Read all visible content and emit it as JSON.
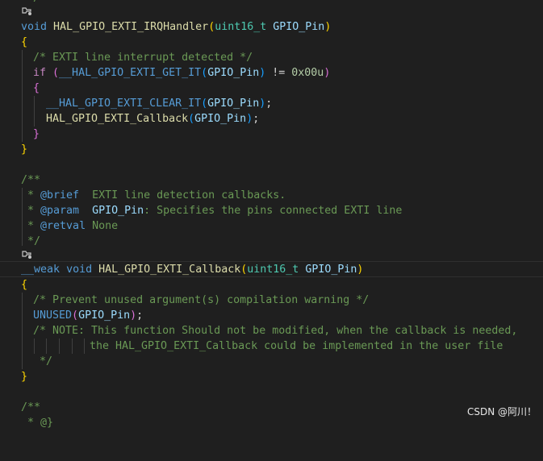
{
  "code": {
    "top_fragment": "/",
    "l1": {
      "void": "void",
      "name": "HAL_GPIO_EXTI_IRQHandler",
      "po": "(",
      "type": "uint16_t",
      "param": "GPIO_Pin",
      "pc": ")"
    },
    "l2": {
      "brace": "{"
    },
    "l3": {
      "comment": "/* EXTI line interrupt detected */"
    },
    "l4": {
      "if": "if",
      "po": "(",
      "macro": "__HAL_GPIO_EXTI_GET_IT",
      "mpo": "(",
      "arg": "GPIO_Pin",
      "mpc": ")",
      "op": " != ",
      "num": "0x00u",
      "pc": ")"
    },
    "l5": {
      "brace": "{"
    },
    "l6": {
      "macro": "__HAL_GPIO_EXTI_CLEAR_IT",
      "po": "(",
      "arg": "GPIO_Pin",
      "pc": ")",
      "semi": ";"
    },
    "l7": {
      "fn": "HAL_GPIO_EXTI_Callback",
      "po": "(",
      "arg": "GPIO_Pin",
      "pc": ")",
      "semi": ";"
    },
    "l8": {
      "brace": "}"
    },
    "l9": {
      "brace": "}"
    },
    "l11": {
      "text": "/**"
    },
    "l12": {
      "star": " * ",
      "tag": "@brief",
      "text": "  EXTI line detection callbacks."
    },
    "l13": {
      "star": " * ",
      "tag": "@param",
      "space": "  ",
      "param": "GPIO_Pin",
      "text": ": Specifies the pins connected EXTI line"
    },
    "l14": {
      "star": " * ",
      "tag": "@retval",
      "text": " None"
    },
    "l15": {
      "text": " */"
    },
    "l16": {
      "weak": "__weak",
      "void": "void",
      "name": "HAL_GPIO_EXTI_Callback",
      "po": "(",
      "type": "uint16_t",
      "param": "GPIO_Pin",
      "pc": ")"
    },
    "l17": {
      "brace": "{"
    },
    "l18": {
      "comment": "/* Prevent unused argument(s) compilation warning */"
    },
    "l19": {
      "macro": "UNUSED",
      "po": "(",
      "arg": "GPIO_Pin",
      "pc": ")",
      "semi": ";"
    },
    "l20": {
      "comment": "/* NOTE: This function Should not be modified, when the callback is needed,"
    },
    "l21": {
      "comment": "the HAL_GPIO_EXTI_Callback could be implemented in the user file"
    },
    "l22": {
      "comment": " */"
    },
    "l23": {
      "brace": "}"
    },
    "l25": {
      "text": "/**"
    },
    "l26": {
      "text": " * @}"
    }
  },
  "watermark": "CSDN @阿川！"
}
